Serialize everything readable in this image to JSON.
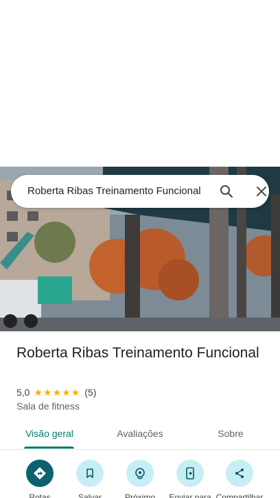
{
  "search": {
    "query": "Roberta Ribas Treinamento Funcional",
    "search_icon": "search-icon",
    "close_icon": "close-icon"
  },
  "place": {
    "name": "Roberta Ribas Treinamento Funcional",
    "rating": "5,0",
    "stars": "★★★★★",
    "review_count": "(5)",
    "category": "Sala de fitness"
  },
  "tabs": [
    {
      "label": "Visão geral",
      "active": true
    },
    {
      "label": "Avaliações",
      "active": false
    },
    {
      "label": "Sobre",
      "active": false
    }
  ],
  "actions": [
    {
      "label": "Rotas",
      "icon": "directions-icon"
    },
    {
      "label": "Salvar",
      "icon": "bookmark-icon"
    },
    {
      "label": "Próximo",
      "icon": "nearby-icon"
    },
    {
      "label": "Enviar para",
      "icon": "send-to-phone-icon"
    },
    {
      "label": "Compartilhar",
      "icon": "share-icon"
    }
  ],
  "colors": {
    "accent": "#00796b",
    "action_bg": "#c8eef5",
    "primary_action_bg": "#0b6171",
    "star": "#f6b100"
  }
}
